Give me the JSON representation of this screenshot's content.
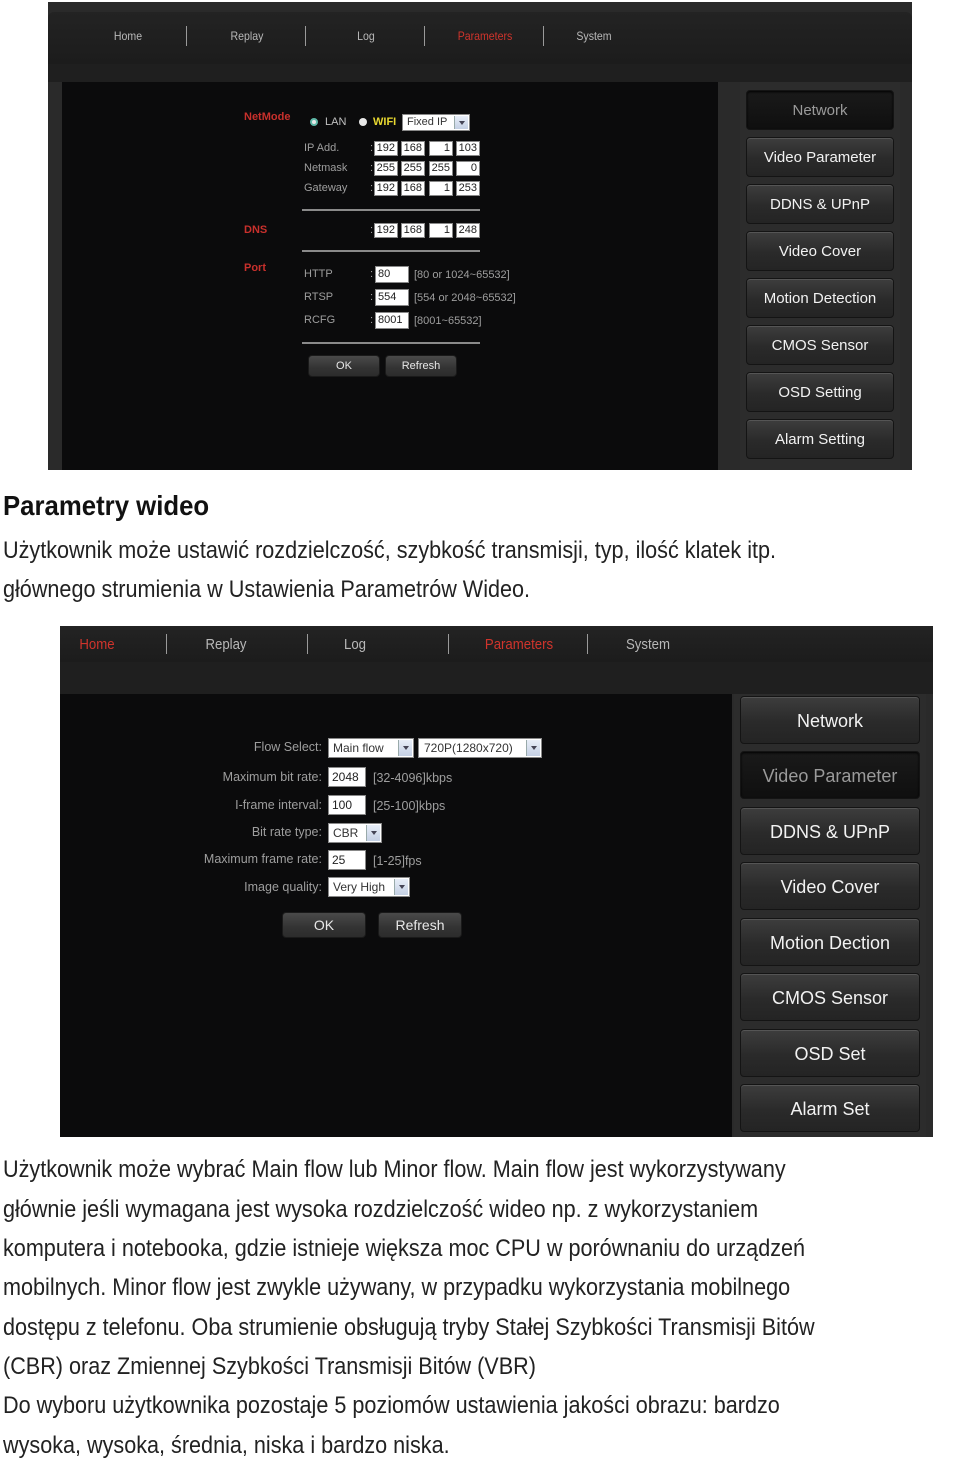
{
  "screenshot1": {
    "nav": {
      "tabs": [
        {
          "label": "Home",
          "active": false
        },
        {
          "label": "Replay",
          "active": false
        },
        {
          "label": "Log",
          "active": false
        },
        {
          "label": "Parameters",
          "active": true
        },
        {
          "label": "System",
          "active": false
        }
      ]
    },
    "netmode": {
      "label": "NetMode",
      "options": [
        {
          "label": "LAN",
          "selected": true
        },
        {
          "label": "WIFI",
          "selected": false
        }
      ],
      "ip_mode": "Fixed IP"
    },
    "ip_fields": [
      {
        "label": "IP Add.",
        "octets": [
          "192",
          "168",
          "1",
          "103"
        ]
      },
      {
        "label": "Netmask",
        "octets": [
          "255",
          "255",
          "255",
          "0"
        ]
      },
      {
        "label": "Gateway",
        "octets": [
          "192",
          "168",
          "1",
          "253"
        ]
      }
    ],
    "dns": {
      "label": "DNS",
      "octets": [
        "192",
        "168",
        "1",
        "248"
      ]
    },
    "port": {
      "label": "Port",
      "rows": [
        {
          "label": "HTTP",
          "value": "80",
          "range": "[80 or 1024~65532]"
        },
        {
          "label": "RTSP",
          "value": "554",
          "range": "[554 or 2048~65532]"
        },
        {
          "label": "RCFG",
          "value": "8001",
          "range": "[8001~65532]"
        }
      ]
    },
    "buttons": {
      "ok": "OK",
      "refresh": "Refresh"
    },
    "sidebar": [
      {
        "label": "Network",
        "active": true
      },
      {
        "label": "Video Parameter",
        "active": false
      },
      {
        "label": "DDNS & UPnP",
        "active": false
      },
      {
        "label": "Video Cover",
        "active": false
      },
      {
        "label": "Motion Detection",
        "active": false
      },
      {
        "label": "CMOS Sensor",
        "active": false
      },
      {
        "label": "OSD Setting",
        "active": false
      },
      {
        "label": "Alarm Setting",
        "active": false
      }
    ]
  },
  "heading": "Parametry wideo",
  "intro_lines": [
    "Użytkownik może ustawić rozdzielczość, szybkość transmisji, typ, ilość klatek itp.",
    "głównego strumienia w Ustawienia Parametrów Wideo."
  ],
  "screenshot2": {
    "nav": {
      "tabs": [
        {
          "label": "Home",
          "active": true
        },
        {
          "label": "Replay",
          "active": false
        },
        {
          "label": "Log",
          "active": false
        },
        {
          "label": "Parameters",
          "active": true
        },
        {
          "label": "System",
          "active": false
        }
      ]
    },
    "form": {
      "flow_select": {
        "label": "Flow Select:",
        "flow": "Main flow",
        "resolution": "720P(1280x720)"
      },
      "max_bit_rate": {
        "label": "Maximum bit rate:",
        "value": "2048",
        "range": "[32-4096]kbps"
      },
      "iframe_interval": {
        "label": "I-frame interval:",
        "value": "100",
        "range": "[25-100]kbps"
      },
      "bit_rate_type": {
        "label": "Bit rate type:",
        "value": "CBR"
      },
      "max_frame_rate": {
        "label": "Maximum frame rate:",
        "value": "25",
        "range": "[1-25]fps"
      },
      "image_quality": {
        "label": "Image quality:",
        "value": "Very High"
      }
    },
    "buttons": {
      "ok": "OK",
      "refresh": "Refresh"
    },
    "sidebar": [
      {
        "label": "Network",
        "active": false
      },
      {
        "label": "Video Parameter",
        "active": true
      },
      {
        "label": "DDNS & UPnP",
        "active": false
      },
      {
        "label": "Video Cover",
        "active": false
      },
      {
        "label": "Motion Dection",
        "active": false
      },
      {
        "label": "CMOS Sensor",
        "active": false
      },
      {
        "label": "OSD Set",
        "active": false
      },
      {
        "label": "Alarm Set",
        "active": false
      }
    ]
  },
  "body_lines": [
    "Użytkownik może wybrać Main flow lub Minor flow. Main flow jest wykorzystywany",
    "głównie jeśli wymagana jest wysoka rozdzielczość wideo np. z wykorzystaniem",
    "komputera i notebooka, gdzie istnieje większa moc CPU w porównaniu do urządzeń",
    "mobilnych. Minor flow jest zwykle używany, w przypadku wykorzystania mobilnego",
    "dostępu z telefonu. Oba strumienie obsługują tryby Stałej Szybkości Transmisji Bitów",
    "(CBR) oraz Zmiennej Szybkości Transmisji Bitów (VBR)",
    "Do wyboru użytkownika pozostaje 5 poziomów ustawienia jakości obrazu: bardzo",
    "wysoka, wysoka, średnia, niska i bardzo niska."
  ]
}
